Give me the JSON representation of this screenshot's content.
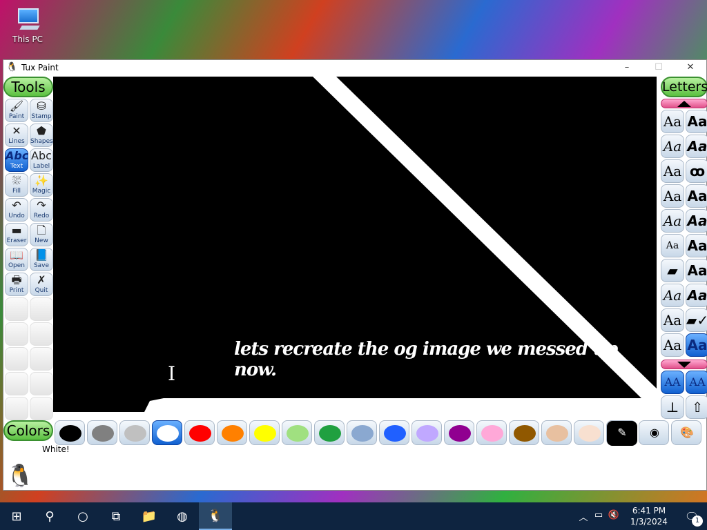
{
  "desktop": {
    "icons": [
      {
        "label": "This PC",
        "icon": "computer-icon"
      }
    ]
  },
  "window": {
    "title": "Tux Paint",
    "controls": {
      "minimize": "–",
      "maximize": "☐",
      "close": "✕"
    }
  },
  "tools": {
    "header": "Tools",
    "items": [
      {
        "label": "Paint",
        "icon": "brush-icon",
        "glyph": "🖌"
      },
      {
        "label": "Stamp",
        "icon": "stamp-icon",
        "glyph": "⛁"
      },
      {
        "label": "Lines",
        "icon": "lines-icon",
        "glyph": "✕"
      },
      {
        "label": "Shapes",
        "icon": "shapes-icon",
        "glyph": "⬟"
      },
      {
        "label": "Text",
        "icon": "text-abc-icon",
        "glyph": "Abc",
        "selected": true
      },
      {
        "label": "Label",
        "icon": "label-abc-icon",
        "glyph": "Abc"
      },
      {
        "label": "Fill",
        "icon": "fill-bucket-icon",
        "glyph": "⛆"
      },
      {
        "label": "Magic",
        "icon": "magic-wand-icon",
        "glyph": "✨"
      },
      {
        "label": "Undo",
        "icon": "undo-icon",
        "glyph": "↶"
      },
      {
        "label": "Redo",
        "icon": "redo-icon",
        "glyph": "↷"
      },
      {
        "label": "Eraser",
        "icon": "eraser-icon",
        "glyph": "▬"
      },
      {
        "label": "New",
        "icon": "new-page-icon",
        "glyph": "🗋"
      },
      {
        "label": "Open",
        "icon": "open-book-icon",
        "glyph": "📖"
      },
      {
        "label": "Save",
        "icon": "save-book-icon",
        "glyph": "📘"
      },
      {
        "label": "Print",
        "icon": "printer-icon",
        "glyph": "🖶"
      },
      {
        "label": "Quit",
        "icon": "quit-x-icon",
        "glyph": "✗"
      }
    ]
  },
  "canvas": {
    "background": "#000000",
    "text": "lets recreate the og image we messed up now."
  },
  "letters": {
    "header": "Letters",
    "fonts": [
      "Aa",
      "Aa",
      "Aa",
      "Aa",
      "Aa",
      "ꝏ",
      "Aa",
      "Aa",
      "Aa",
      "Aa",
      "Aa",
      "Aa",
      "▰",
      "Aa",
      "Aa",
      "Aa",
      "Aa",
      "▰✓",
      "Aa",
      "Aa"
    ],
    "size_buttons": [
      "AA",
      "AA"
    ],
    "bottom_buttons": [
      {
        "icon": "text-bottom-icon",
        "glyph": "⊥"
      },
      {
        "icon": "arrow-up-icon",
        "glyph": "⇧"
      }
    ]
  },
  "colors": {
    "header": "Colors",
    "selected_name": "White!",
    "swatches": [
      {
        "name": "black",
        "hex": "#000000"
      },
      {
        "name": "gray",
        "hex": "#808080"
      },
      {
        "name": "silver",
        "hex": "#c0c0c0"
      },
      {
        "name": "white",
        "hex": "#ffffff",
        "selected": true
      },
      {
        "name": "red",
        "hex": "#ff0000"
      },
      {
        "name": "orange",
        "hex": "#ff8000"
      },
      {
        "name": "yellow",
        "hex": "#ffff00"
      },
      {
        "name": "light-green",
        "hex": "#a0e080"
      },
      {
        "name": "green",
        "hex": "#20a040"
      },
      {
        "name": "steel-blue",
        "hex": "#8aa8d0"
      },
      {
        "name": "blue",
        "hex": "#2060ff"
      },
      {
        "name": "lavender",
        "hex": "#c0a8ff"
      },
      {
        "name": "purple",
        "hex": "#900090"
      },
      {
        "name": "pink",
        "hex": "#ffa8d8"
      },
      {
        "name": "brown",
        "hex": "#905800"
      },
      {
        "name": "tan",
        "hex": "#e8c0a0"
      },
      {
        "name": "cream",
        "hex": "#f8e0d0"
      }
    ],
    "extra_tools": [
      {
        "icon": "color-picker-icon",
        "glyph": "✎"
      },
      {
        "icon": "rainbow-palette-icon",
        "glyph": "◉"
      },
      {
        "icon": "color-mixer-icon",
        "glyph": "🎨"
      }
    ]
  },
  "taskbar": {
    "items": [
      {
        "icon": "windows-start-icon",
        "glyph": "⊞"
      },
      {
        "icon": "search-icon",
        "glyph": "⚲"
      },
      {
        "icon": "cortana-icon",
        "glyph": "○"
      },
      {
        "icon": "task-view-icon",
        "glyph": "⧉"
      },
      {
        "icon": "file-explorer-icon",
        "glyph": "📁"
      },
      {
        "icon": "chrome-icon",
        "glyph": "◍"
      },
      {
        "icon": "tux-paint-icon",
        "glyph": "🐧",
        "active": true
      }
    ],
    "tray": {
      "icons": [
        {
          "icon": "chevron-up-icon",
          "glyph": "︿"
        },
        {
          "icon": "network-icon",
          "glyph": "▭"
        },
        {
          "icon": "volume-muted-icon",
          "glyph": "🔇"
        }
      ],
      "time": "6:41 PM",
      "date": "1/3/2024",
      "notification_count": "1"
    }
  }
}
